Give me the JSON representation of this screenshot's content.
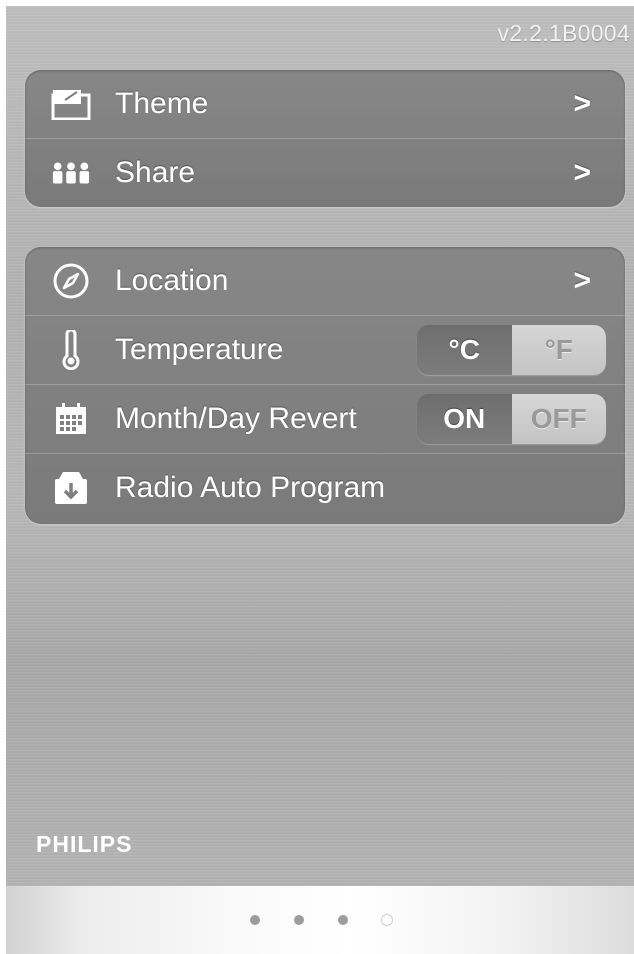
{
  "header": {
    "version": "v2.2.1B0004"
  },
  "settings": {
    "group1": [
      {
        "label": "Theme",
        "icon": "theme-icon",
        "chevron": ">"
      },
      {
        "label": "Share",
        "icon": "people-icon",
        "chevron": ">"
      }
    ],
    "group2": {
      "location": {
        "label": "Location",
        "icon": "compass-icon",
        "chevron": ">"
      },
      "temperature": {
        "label": "Temperature",
        "icon": "thermometer-icon",
        "options": [
          "°C",
          "°F"
        ],
        "selected": "°C"
      },
      "month_day": {
        "label": "Month/Day Revert",
        "icon": "calendar-icon",
        "options": [
          "ON",
          "OFF"
        ],
        "selected": "ON"
      },
      "radio": {
        "label": "Radio Auto Program",
        "icon": "download-box-icon"
      }
    }
  },
  "brand": {
    "name": "PHILIPS"
  },
  "pager": {
    "count": 4,
    "active_index": 3
  },
  "colors": {
    "panel": "#808080",
    "background": "#b5b5b5",
    "text": "#ffffff"
  }
}
